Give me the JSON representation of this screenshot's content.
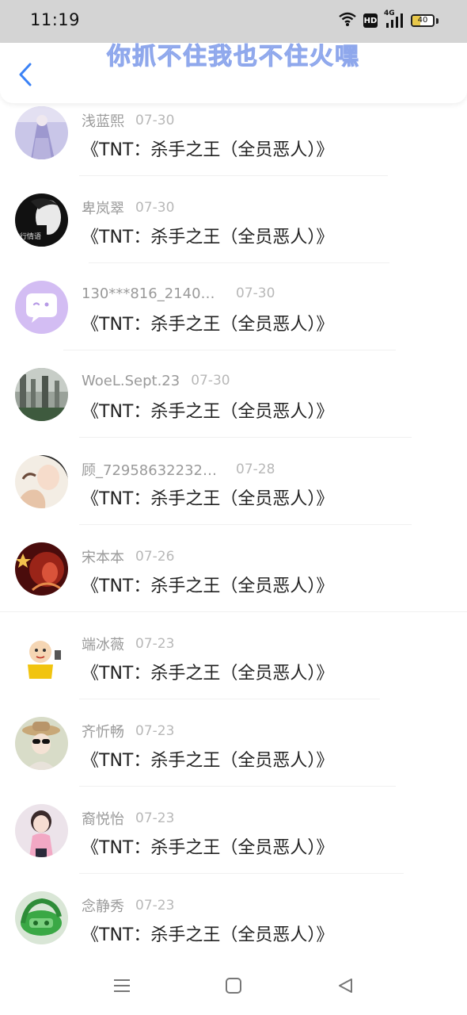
{
  "status_bar": {
    "time": "11:19",
    "network": "4G",
    "hd": "HD",
    "battery": "40",
    "battery_level_percent": 40
  },
  "header": {
    "title": "你抓不住我也不住火嘿",
    "back_icon": "chevron-left-icon",
    "accent_color": "#3b82f6"
  },
  "entries": [
    {
      "user": "浅蓝熙",
      "date": "07-30",
      "book": "《TNT：杀手之王（全员恶人）》"
    },
    {
      "user": "卑岚翠",
      "date": "07-30",
      "book": "《TNT：杀手之王（全员恶人）》"
    },
    {
      "user": "130***816_21400...",
      "date": "07-30",
      "book": "《TNT：杀手之王（全员恶人）》"
    },
    {
      "user": "WoeL.Sept.23",
      "date": "07-30",
      "book": "《TNT：杀手之王（全员恶人）》"
    },
    {
      "user": "顾_729586322321...",
      "date": "07-28",
      "book": "《TNT：杀手之王（全员恶人）》"
    },
    {
      "user": "宋本本",
      "date": "07-26",
      "book": "《TNT：杀手之王（全员恶人）》"
    },
    {
      "user": "端冰薇",
      "date": "07-23",
      "book": "《TNT：杀手之王（全员恶人）》"
    },
    {
      "user": "齐忻畅",
      "date": "07-23",
      "book": "《TNT：杀手之王（全员恶人）》"
    },
    {
      "user": "裔悦怡",
      "date": "07-23",
      "book": "《TNT：杀手之王（全员恶人）》"
    },
    {
      "user": "念静秀",
      "date": "07-23",
      "book": "《TNT：杀手之王（全员恶人）》"
    }
  ],
  "nav": {
    "menu_icon": "menu-icon",
    "home_icon": "square-home-icon",
    "back_icon": "triangle-back-icon"
  }
}
